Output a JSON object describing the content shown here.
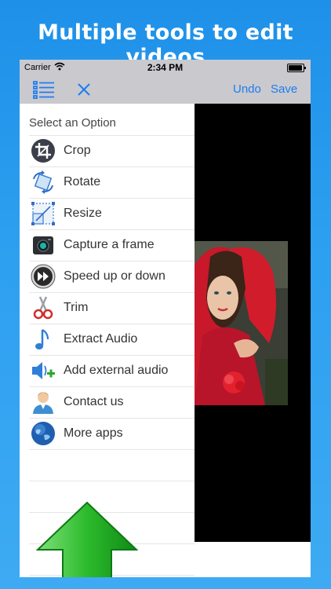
{
  "headline": "Multiple tools to edit videos",
  "status": {
    "carrier": "Carrier",
    "time": "2:34 PM"
  },
  "nav": {
    "undo": "Undo",
    "save": "Save"
  },
  "menu": {
    "title": "Select an Option",
    "items": [
      {
        "label": "Crop",
        "icon": "crop-icon"
      },
      {
        "label": "Rotate",
        "icon": "rotate-icon"
      },
      {
        "label": "Resize",
        "icon": "resize-icon"
      },
      {
        "label": "Capture a frame",
        "icon": "camera-icon"
      },
      {
        "label": "Speed up or down",
        "icon": "fast-forward-icon"
      },
      {
        "label": "Trim",
        "icon": "scissors-icon"
      },
      {
        "label": "Extract Audio",
        "icon": "music-note-icon"
      },
      {
        "label": "Add external audio",
        "icon": "speaker-add-icon"
      },
      {
        "label": "Contact us",
        "icon": "person-icon"
      },
      {
        "label": "More apps",
        "icon": "globe-icon"
      }
    ]
  },
  "colors": {
    "accent": "#1f7cf0",
    "navbar": "#c9c9ce",
    "arrow": "#1fa82a"
  }
}
